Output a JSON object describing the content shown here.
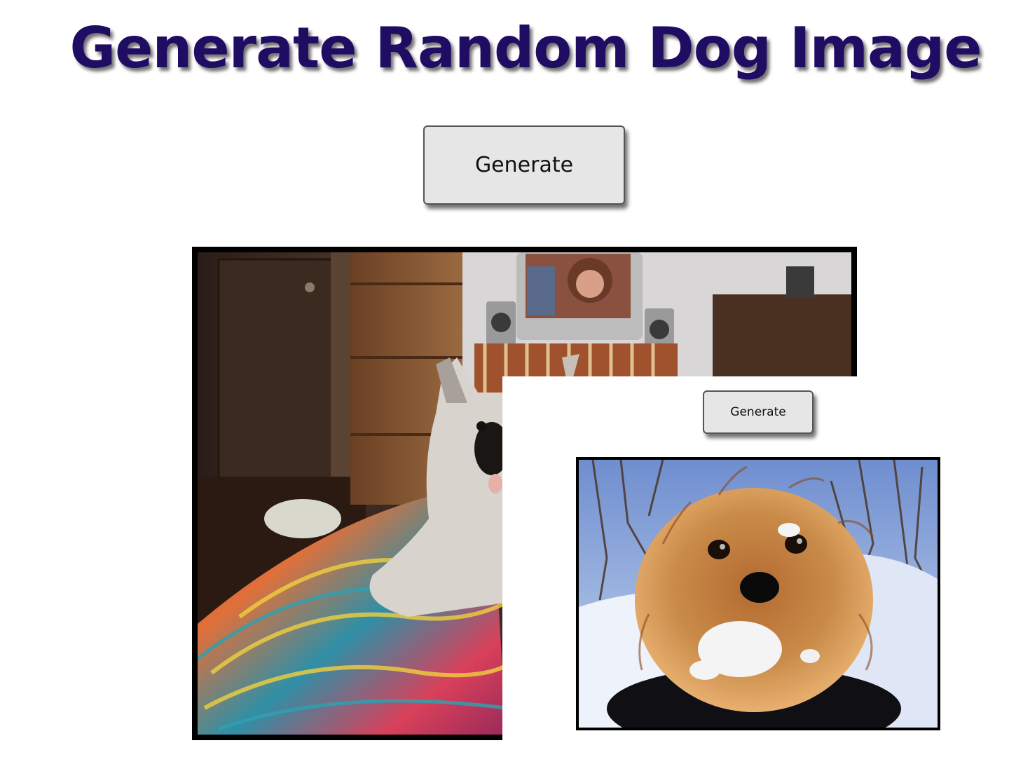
{
  "page": {
    "title": "Generate Random Dog Image",
    "generate_button_label": "Generate"
  },
  "overlay": {
    "generate_button_label": "Generate"
  },
  "colors": {
    "title": "#1f0c63",
    "button_bg": "#e6e6e6",
    "image_border": "#000000"
  }
}
